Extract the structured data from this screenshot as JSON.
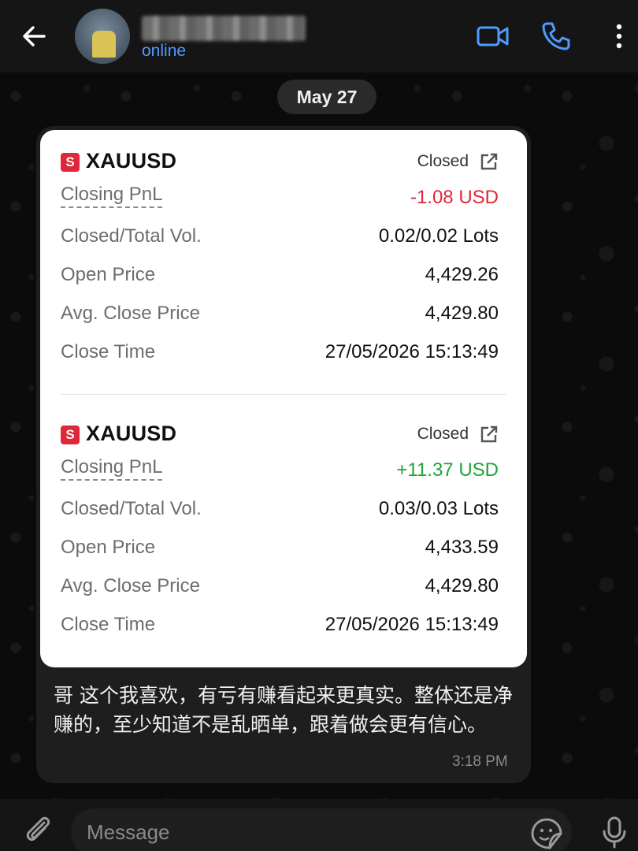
{
  "header": {
    "contact_name": "",
    "status": "online",
    "icons": [
      "back-arrow-icon",
      "video-camera-icon",
      "phone-icon",
      "more-vertical-icon"
    ]
  },
  "date_pill": "May 27",
  "message": {
    "trades": [
      {
        "badge": "S",
        "symbol": "XAUUSD",
        "status": "Closed",
        "rows": [
          {
            "label": "Closing PnL",
            "value": "-1.08 USD"
          },
          {
            "label": "Closed/Total Vol.",
            "value": "0.02/0.02 Lots"
          },
          {
            "label": "Open Price",
            "value": "4,429.26"
          },
          {
            "label": "Avg. Close Price",
            "value": "4,429.80"
          },
          {
            "label": "Close Time",
            "value": "27/05/2026 15:13:49"
          }
        ]
      },
      {
        "badge": "S",
        "symbol": "XAUUSD",
        "status": "Closed",
        "rows": [
          {
            "label": "Closing PnL",
            "value": "+11.37 USD"
          },
          {
            "label": "Closed/Total Vol.",
            "value": "0.03/0.03 Lots"
          },
          {
            "label": "Open Price",
            "value": "4,433.59"
          },
          {
            "label": "Avg. Close Price",
            "value": "4,429.80"
          },
          {
            "label": "Close Time",
            "value": "27/05/2026 15:13:49"
          }
        ]
      }
    ],
    "colors": {
      "loss": "#e0263a",
      "profit": "#1fa33a",
      "badge": "#e0263a"
    },
    "text": "哥 这个我喜欢，有亏有赚看起来更真实。整体还是净赚的，至少知道不是乱晒单，跟着做会更有信心。",
    "time": "3:18 PM"
  },
  "composer": {
    "placeholder": "Message",
    "icons": [
      "paperclip-icon",
      "sticker-icon",
      "microphone-icon"
    ]
  }
}
